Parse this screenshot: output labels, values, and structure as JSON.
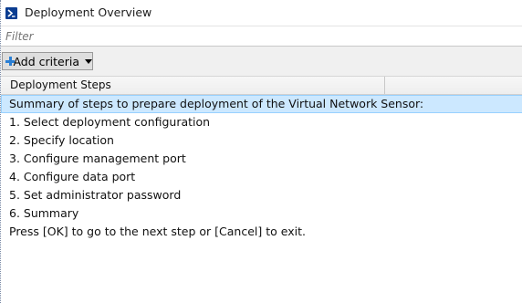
{
  "window": {
    "title": "Deployment Overview"
  },
  "filter": {
    "placeholder": "Filter"
  },
  "toolbar": {
    "add_criteria_label": "Add criteria"
  },
  "table": {
    "column_header": "Deployment Steps",
    "rows": [
      "Summary of steps to prepare deployment of the Virtual Network Sensor:",
      "1. Select deployment configuration",
      "2. Specify location",
      "3. Configure management port",
      "4. Configure data port",
      "5. Set administrator password",
      "6. Summary",
      "Press [OK] to go to the next step or [Cancel] to exit."
    ],
    "selected_row_index": 0
  },
  "colors": {
    "selection_bg": "#cce8ff",
    "selection_border": "#99d1ff",
    "add_icon": "#2a7fd4",
    "powershell_icon": "#0b3d91"
  },
  "icons": {
    "window": "powershell-icon",
    "add": "plus-icon",
    "dropdown": "dropdown-arrow-icon"
  }
}
